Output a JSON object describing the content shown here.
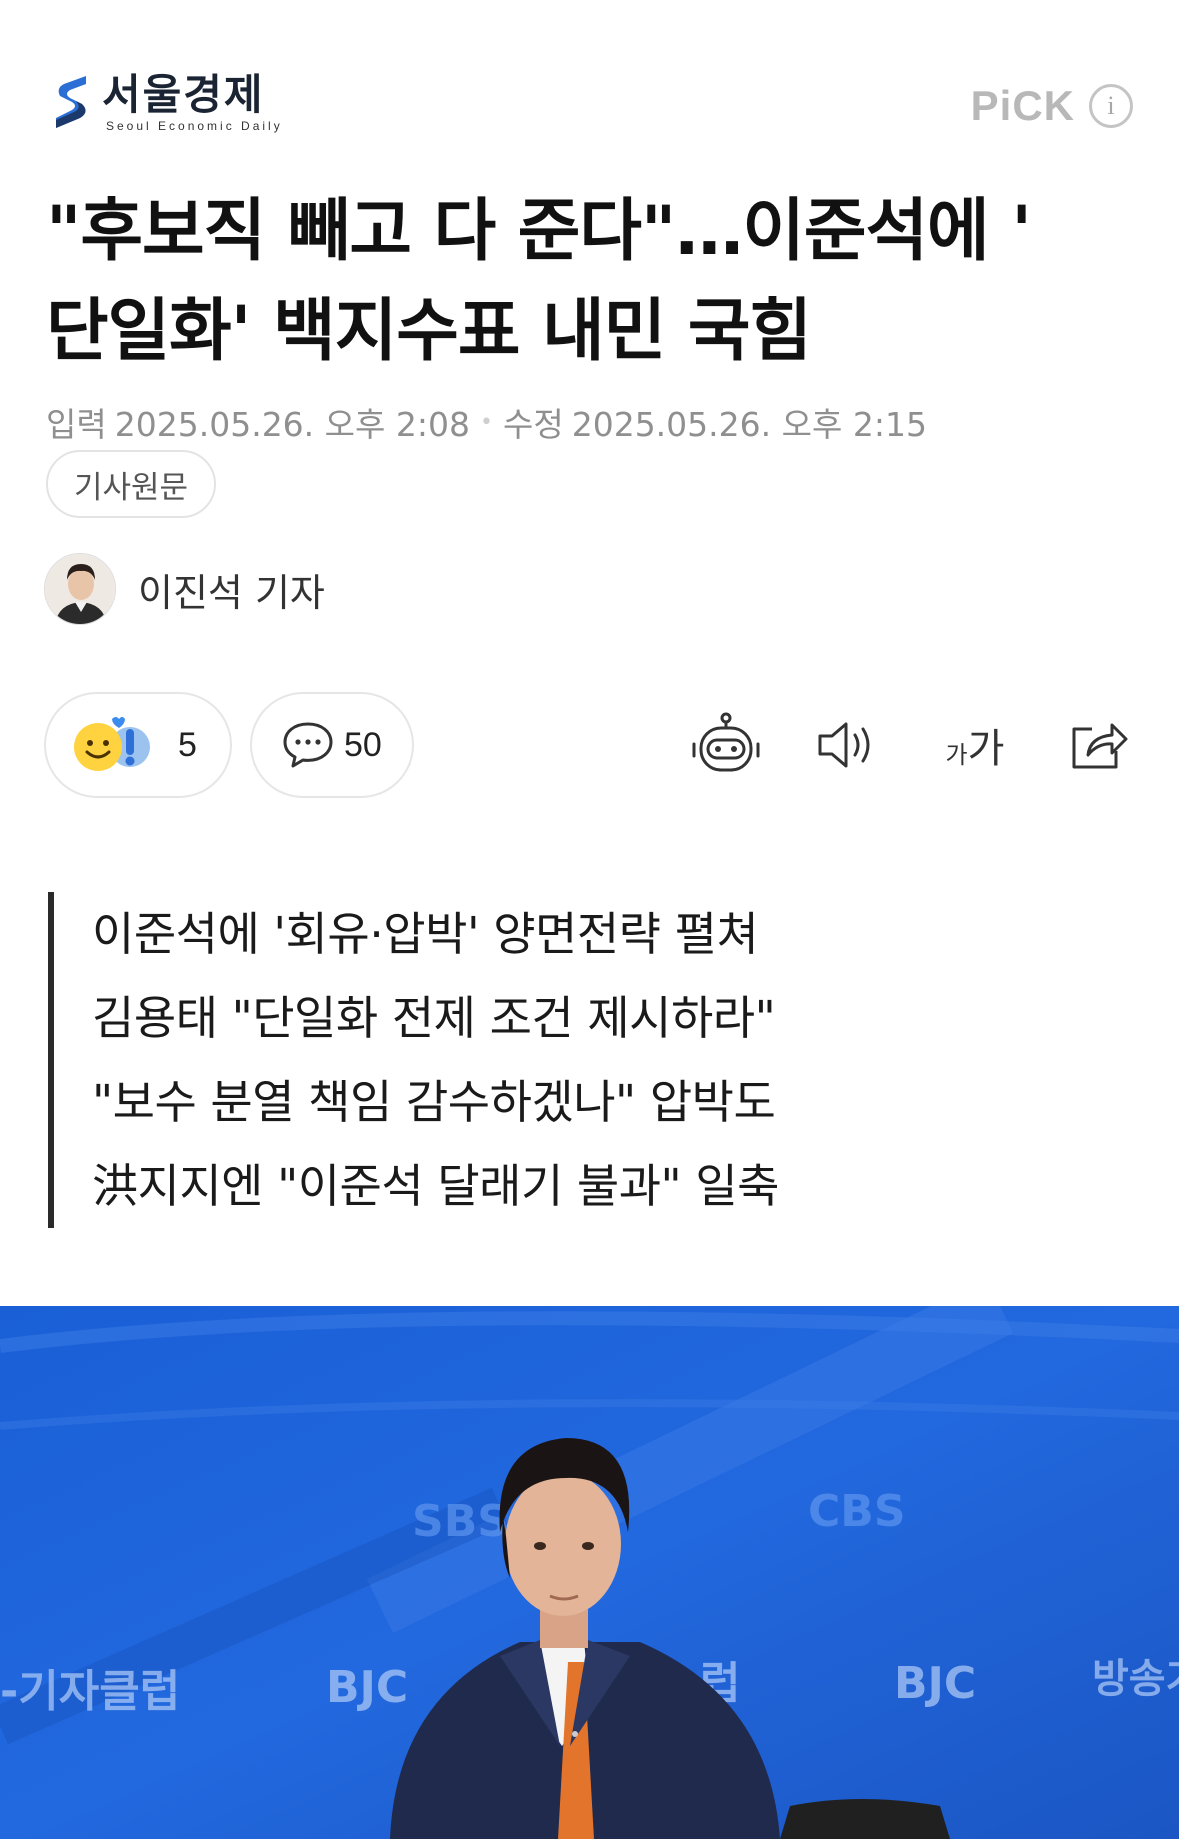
{
  "header": {
    "logo_kr": "서울경제",
    "logo_en": "Seoul Economic Daily",
    "pick_label": "PiCK",
    "pick_info": "i"
  },
  "article": {
    "title_line1": "\"후보직 빼고 다 준다\"…이준석에 '",
    "title_line2": "단일화' 백지수표 내민 국힘",
    "input_label": "입력",
    "input_time": "2025.05.26. 오후 2:08",
    "separator": "•",
    "edit_label": "수정",
    "edit_time": "2025.05.26. 오후 2:15",
    "source_button": "기사원문",
    "author": "이진석 기자"
  },
  "reactions": {
    "emotion_count": "5",
    "comment_count": "50"
  },
  "tools": {
    "font_small": "가",
    "font_large": "가"
  },
  "summary": [
    "이준석에 '회유·압박' 양면전략 펼쳐",
    "김용태 \"단일화 전제 조건 제시하라\"",
    "\"보수 분열 책임 감수하겠나\" 압박도",
    "洪지지엔 \"이준석 달래기 불과\" 일축"
  ],
  "photo": {
    "backdrop_texts": [
      "SBS",
      "CBS",
      "BJC",
      "BJC",
      "-기자클럽",
      "방송기",
      "럽"
    ]
  },
  "colors": {
    "logo_blue": "#2b6fd6",
    "logo_dark": "#1b2433",
    "meta_gray": "#8f8f8f",
    "photo_blue": "#1f63d8"
  }
}
